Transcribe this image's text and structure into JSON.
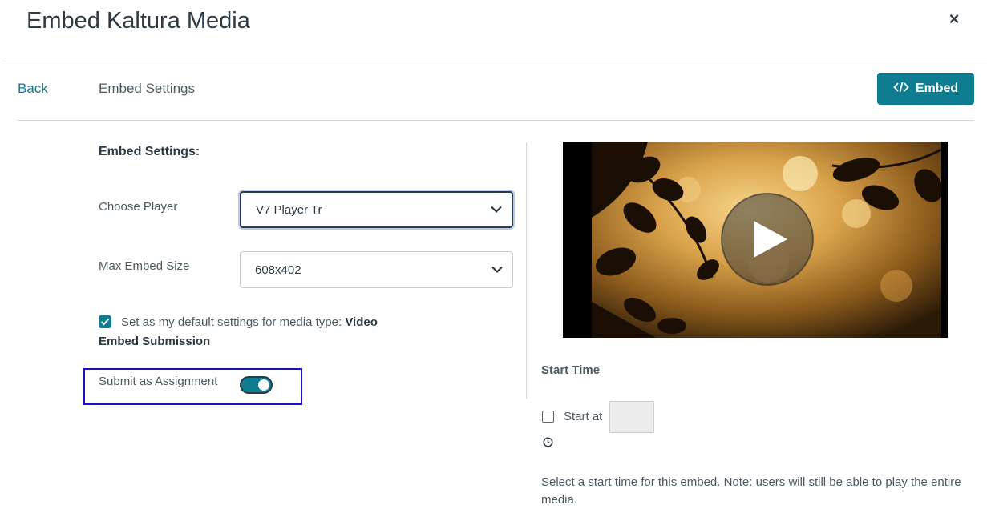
{
  "dialog": {
    "title": "Embed Kaltura Media",
    "close_glyph": "×"
  },
  "toolbar": {
    "back_label": "Back",
    "breadcrumb": "Embed Settings",
    "embed_label": "Embed",
    "embed_icon": "code-icon",
    "accent_color": "#0d7d8f"
  },
  "settings": {
    "section_title": "Embed Settings:",
    "player": {
      "label": "Choose Player",
      "value": "V7 Player Tr"
    },
    "size": {
      "label": "Max Embed Size",
      "value": "608x402"
    },
    "default_checkbox": {
      "checked": true,
      "label_prefix": "Set as my default settings for media type: ",
      "label_type": "Video"
    },
    "submission_title": "Embed Submission",
    "assignment": {
      "label": "Submit as Assignment",
      "on": true
    }
  },
  "preview": {
    "play_icon": "play-icon"
  },
  "start_time": {
    "title": "Start Time",
    "checkbox_label": "Start at",
    "checked": false,
    "input_value": "",
    "clock_icon": "clock-icon",
    "help": "Select a start time for this embed. Note: users will still be able to play the entire media."
  }
}
